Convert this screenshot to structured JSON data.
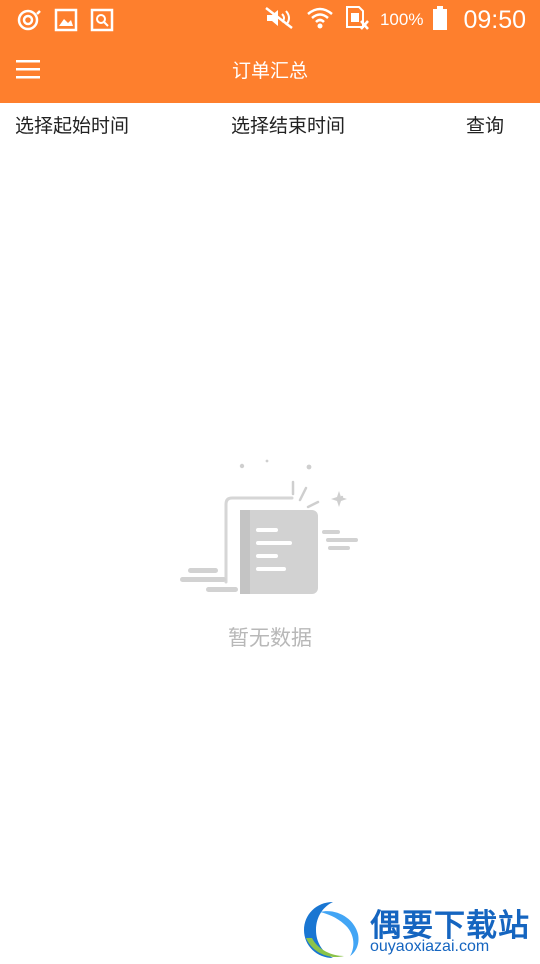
{
  "status_bar": {
    "battery_text": "100%",
    "time": "09:50",
    "left_icons": [
      "sync-icon",
      "gallery-icon",
      "search-app-icon"
    ],
    "right_icons": [
      "mute-icon",
      "wifi-icon",
      "sim-icon",
      "battery-icon"
    ]
  },
  "app_bar": {
    "title": "订单汇总",
    "menu_icon": "hamburger-menu-icon",
    "background": "#fe7f2d"
  },
  "filters": {
    "start_label": "选择起始时间",
    "end_label": "选择结束时间",
    "query_label": "查询"
  },
  "empty": {
    "message": "暂无数据",
    "icon": "empty-document-icon"
  },
  "watermark": {
    "title": "偶要下载站",
    "url": "ouyaoxiazai.com"
  },
  "colors": {
    "accent": "#fe7f2d",
    "empty_text": "#b8b8b8",
    "watermark": "#1565c0"
  }
}
